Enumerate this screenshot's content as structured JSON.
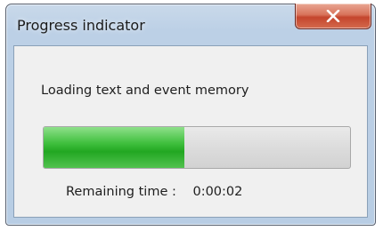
{
  "window": {
    "title": "Progress indicator",
    "close_icon": "close-x-icon"
  },
  "dialog": {
    "message": "Loading text and event memory",
    "progress_fraction": 0.46,
    "remaining_label": "Remaining time :",
    "remaining_value": "0:00:02"
  },
  "colors": {
    "progress_fill": "#2db52b",
    "close_button": "#c94a32"
  }
}
